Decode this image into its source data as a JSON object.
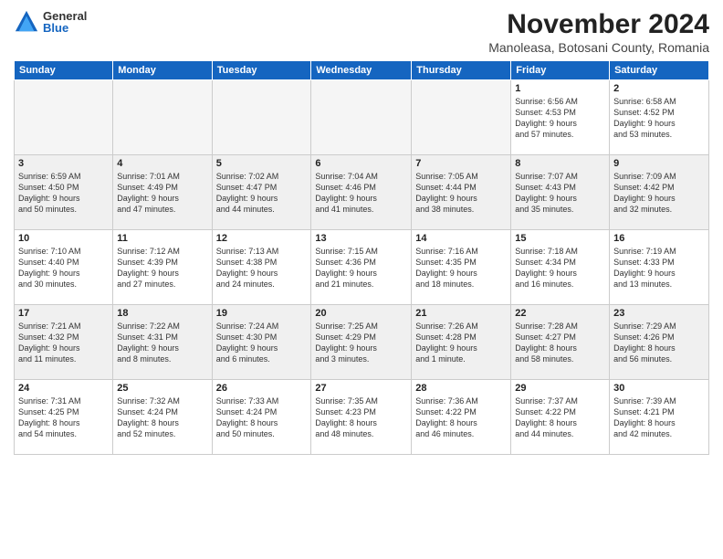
{
  "logo": {
    "general": "General",
    "blue": "Blue"
  },
  "title": "November 2024",
  "subtitle": "Manoleasa, Botosani County, Romania",
  "days_header": [
    "Sunday",
    "Monday",
    "Tuesday",
    "Wednesday",
    "Thursday",
    "Friday",
    "Saturday"
  ],
  "weeks": [
    {
      "shaded": false,
      "days": [
        {
          "num": "",
          "empty": true,
          "lines": []
        },
        {
          "num": "",
          "empty": true,
          "lines": []
        },
        {
          "num": "",
          "empty": true,
          "lines": []
        },
        {
          "num": "",
          "empty": true,
          "lines": []
        },
        {
          "num": "",
          "empty": true,
          "lines": []
        },
        {
          "num": "1",
          "empty": false,
          "lines": [
            "Sunrise: 6:56 AM",
            "Sunset: 4:53 PM",
            "Daylight: 9 hours",
            "and 57 minutes."
          ]
        },
        {
          "num": "2",
          "empty": false,
          "lines": [
            "Sunrise: 6:58 AM",
            "Sunset: 4:52 PM",
            "Daylight: 9 hours",
            "and 53 minutes."
          ]
        }
      ]
    },
    {
      "shaded": true,
      "days": [
        {
          "num": "3",
          "empty": false,
          "lines": [
            "Sunrise: 6:59 AM",
            "Sunset: 4:50 PM",
            "Daylight: 9 hours",
            "and 50 minutes."
          ]
        },
        {
          "num": "4",
          "empty": false,
          "lines": [
            "Sunrise: 7:01 AM",
            "Sunset: 4:49 PM",
            "Daylight: 9 hours",
            "and 47 minutes."
          ]
        },
        {
          "num": "5",
          "empty": false,
          "lines": [
            "Sunrise: 7:02 AM",
            "Sunset: 4:47 PM",
            "Daylight: 9 hours",
            "and 44 minutes."
          ]
        },
        {
          "num": "6",
          "empty": false,
          "lines": [
            "Sunrise: 7:04 AM",
            "Sunset: 4:46 PM",
            "Daylight: 9 hours",
            "and 41 minutes."
          ]
        },
        {
          "num": "7",
          "empty": false,
          "lines": [
            "Sunrise: 7:05 AM",
            "Sunset: 4:44 PM",
            "Daylight: 9 hours",
            "and 38 minutes."
          ]
        },
        {
          "num": "8",
          "empty": false,
          "lines": [
            "Sunrise: 7:07 AM",
            "Sunset: 4:43 PM",
            "Daylight: 9 hours",
            "and 35 minutes."
          ]
        },
        {
          "num": "9",
          "empty": false,
          "lines": [
            "Sunrise: 7:09 AM",
            "Sunset: 4:42 PM",
            "Daylight: 9 hours",
            "and 32 minutes."
          ]
        }
      ]
    },
    {
      "shaded": false,
      "days": [
        {
          "num": "10",
          "empty": false,
          "lines": [
            "Sunrise: 7:10 AM",
            "Sunset: 4:40 PM",
            "Daylight: 9 hours",
            "and 30 minutes."
          ]
        },
        {
          "num": "11",
          "empty": false,
          "lines": [
            "Sunrise: 7:12 AM",
            "Sunset: 4:39 PM",
            "Daylight: 9 hours",
            "and 27 minutes."
          ]
        },
        {
          "num": "12",
          "empty": false,
          "lines": [
            "Sunrise: 7:13 AM",
            "Sunset: 4:38 PM",
            "Daylight: 9 hours",
            "and 24 minutes."
          ]
        },
        {
          "num": "13",
          "empty": false,
          "lines": [
            "Sunrise: 7:15 AM",
            "Sunset: 4:36 PM",
            "Daylight: 9 hours",
            "and 21 minutes."
          ]
        },
        {
          "num": "14",
          "empty": false,
          "lines": [
            "Sunrise: 7:16 AM",
            "Sunset: 4:35 PM",
            "Daylight: 9 hours",
            "and 18 minutes."
          ]
        },
        {
          "num": "15",
          "empty": false,
          "lines": [
            "Sunrise: 7:18 AM",
            "Sunset: 4:34 PM",
            "Daylight: 9 hours",
            "and 16 minutes."
          ]
        },
        {
          "num": "16",
          "empty": false,
          "lines": [
            "Sunrise: 7:19 AM",
            "Sunset: 4:33 PM",
            "Daylight: 9 hours",
            "and 13 minutes."
          ]
        }
      ]
    },
    {
      "shaded": true,
      "days": [
        {
          "num": "17",
          "empty": false,
          "lines": [
            "Sunrise: 7:21 AM",
            "Sunset: 4:32 PM",
            "Daylight: 9 hours",
            "and 11 minutes."
          ]
        },
        {
          "num": "18",
          "empty": false,
          "lines": [
            "Sunrise: 7:22 AM",
            "Sunset: 4:31 PM",
            "Daylight: 9 hours",
            "and 8 minutes."
          ]
        },
        {
          "num": "19",
          "empty": false,
          "lines": [
            "Sunrise: 7:24 AM",
            "Sunset: 4:30 PM",
            "Daylight: 9 hours",
            "and 6 minutes."
          ]
        },
        {
          "num": "20",
          "empty": false,
          "lines": [
            "Sunrise: 7:25 AM",
            "Sunset: 4:29 PM",
            "Daylight: 9 hours",
            "and 3 minutes."
          ]
        },
        {
          "num": "21",
          "empty": false,
          "lines": [
            "Sunrise: 7:26 AM",
            "Sunset: 4:28 PM",
            "Daylight: 9 hours",
            "and 1 minute."
          ]
        },
        {
          "num": "22",
          "empty": false,
          "lines": [
            "Sunrise: 7:28 AM",
            "Sunset: 4:27 PM",
            "Daylight: 8 hours",
            "and 58 minutes."
          ]
        },
        {
          "num": "23",
          "empty": false,
          "lines": [
            "Sunrise: 7:29 AM",
            "Sunset: 4:26 PM",
            "Daylight: 8 hours",
            "and 56 minutes."
          ]
        }
      ]
    },
    {
      "shaded": false,
      "days": [
        {
          "num": "24",
          "empty": false,
          "lines": [
            "Sunrise: 7:31 AM",
            "Sunset: 4:25 PM",
            "Daylight: 8 hours",
            "and 54 minutes."
          ]
        },
        {
          "num": "25",
          "empty": false,
          "lines": [
            "Sunrise: 7:32 AM",
            "Sunset: 4:24 PM",
            "Daylight: 8 hours",
            "and 52 minutes."
          ]
        },
        {
          "num": "26",
          "empty": false,
          "lines": [
            "Sunrise: 7:33 AM",
            "Sunset: 4:24 PM",
            "Daylight: 8 hours",
            "and 50 minutes."
          ]
        },
        {
          "num": "27",
          "empty": false,
          "lines": [
            "Sunrise: 7:35 AM",
            "Sunset: 4:23 PM",
            "Daylight: 8 hours",
            "and 48 minutes."
          ]
        },
        {
          "num": "28",
          "empty": false,
          "lines": [
            "Sunrise: 7:36 AM",
            "Sunset: 4:22 PM",
            "Daylight: 8 hours",
            "and 46 minutes."
          ]
        },
        {
          "num": "29",
          "empty": false,
          "lines": [
            "Sunrise: 7:37 AM",
            "Sunset: 4:22 PM",
            "Daylight: 8 hours",
            "and 44 minutes."
          ]
        },
        {
          "num": "30",
          "empty": false,
          "lines": [
            "Sunrise: 7:39 AM",
            "Sunset: 4:21 PM",
            "Daylight: 8 hours",
            "and 42 minutes."
          ]
        }
      ]
    }
  ]
}
